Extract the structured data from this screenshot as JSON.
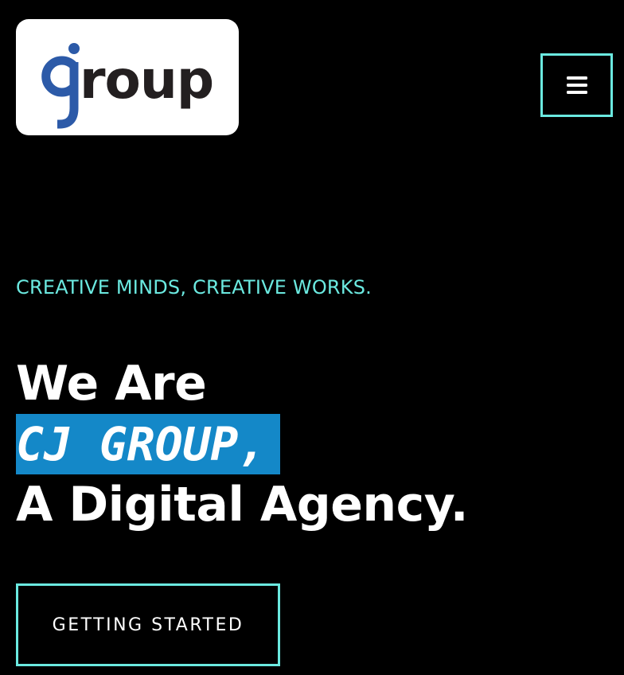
{
  "header": {
    "logo_text": "group",
    "menu_icon": "hamburger-menu-icon"
  },
  "hero": {
    "tagline": "CREATIVE MINDS, CREATIVE WORKS.",
    "headline_line1": "We Are",
    "headline_highlight": "CJ GROUP,",
    "headline_line3": "A Digital Agency.",
    "cta_label": "GETTING STARTED"
  },
  "colors": {
    "background": "#000000",
    "accent_cyan": "#6be9e0",
    "highlight_blue": "#1488c8",
    "logo_blue": "#2c5aa8",
    "logo_dark": "#231f20"
  }
}
